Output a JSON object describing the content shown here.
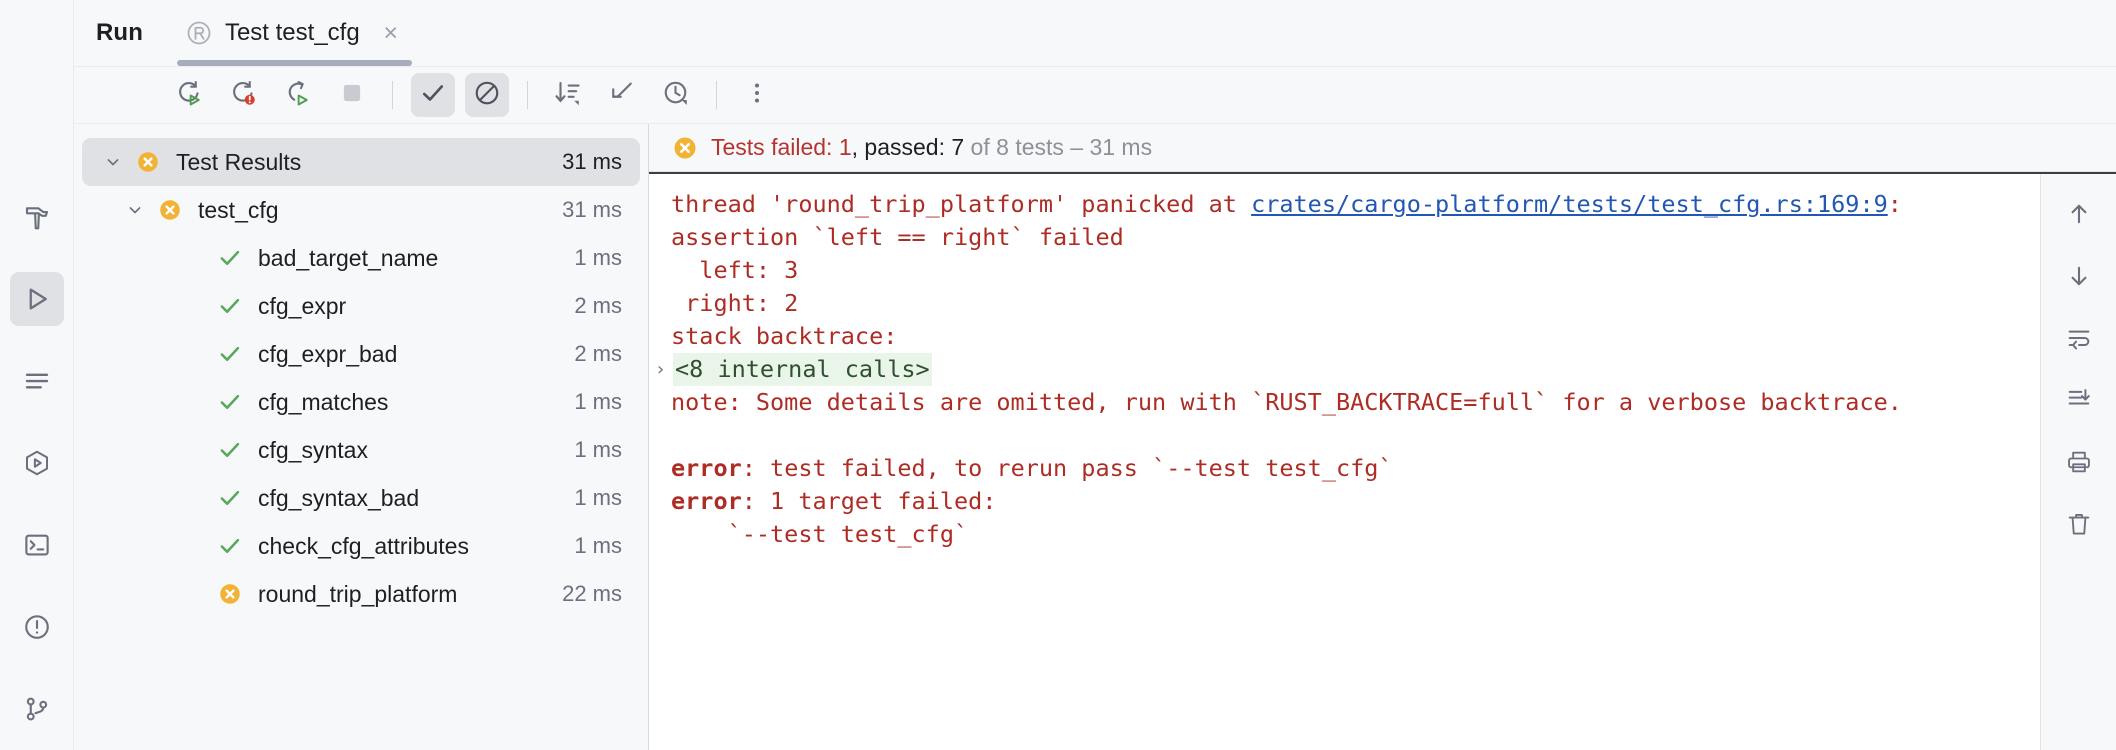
{
  "window": {
    "tool_window_title": "Run"
  },
  "tab": {
    "icon": "rust-logo-icon",
    "label": "Test test_cfg",
    "close_label": "×"
  },
  "toolbar": {
    "buttons": [
      {
        "name": "rerun-button",
        "tooltip": "Rerun",
        "icon": "rerun-icon",
        "toggled": false
      },
      {
        "name": "rerun-failed-tests-button",
        "tooltip": "Rerun Failed Tests",
        "icon": "rerun-failed-icon",
        "toggled": false
      },
      {
        "name": "toggle-auto-test-button",
        "tooltip": "Toggle auto-test",
        "icon": "auto-test-icon",
        "toggled": false
      },
      {
        "name": "stop-button",
        "tooltip": "Stop",
        "icon": "stop-icon",
        "toggled": false
      },
      {
        "name": "show-passed-button",
        "tooltip": "Show Passed",
        "icon": "check-icon",
        "toggled": true
      },
      {
        "name": "show-ignored-button",
        "tooltip": "Show Ignored",
        "icon": "no-entry-icon",
        "toggled": true
      },
      {
        "name": "sort-button",
        "tooltip": "Sort by Duration",
        "icon": "sort-descending-icon",
        "toggled": false
      },
      {
        "name": "expand-collapse-button",
        "tooltip": "Collapse",
        "icon": "collapse-arrow-icon",
        "toggled": false
      },
      {
        "name": "test-history-button",
        "tooltip": "Test History",
        "icon": "clock-icon",
        "toggled": false
      },
      {
        "name": "more-options-button",
        "tooltip": "More Options",
        "icon": "vertical-ellipsis-icon",
        "toggled": false
      }
    ]
  },
  "gutter": {
    "items": [
      {
        "name": "sidebar-item-build",
        "icon": "hammer-icon",
        "active": false
      },
      {
        "name": "sidebar-item-run",
        "icon": "play-icon",
        "active": true
      },
      {
        "name": "sidebar-item-todo",
        "icon": "lines-icon",
        "active": false
      },
      {
        "name": "sidebar-item-services",
        "icon": "hexagon-play-icon",
        "active": false
      },
      {
        "name": "sidebar-item-terminal",
        "icon": "terminal-icon",
        "active": false
      },
      {
        "name": "sidebar-item-problems",
        "icon": "warning-circle-icon",
        "active": false
      },
      {
        "name": "sidebar-item-version-control",
        "icon": "git-branch-icon",
        "active": false
      }
    ]
  },
  "tree": {
    "rows": [
      {
        "label": "Test Results",
        "time": "31 ms",
        "status": "failed",
        "indent": 1,
        "arrow": "expanded",
        "selected": true
      },
      {
        "label": "test_cfg",
        "time": "31 ms",
        "status": "failed",
        "indent": 2,
        "arrow": "expanded",
        "selected": false
      },
      {
        "label": "bad_target_name",
        "time": "1 ms",
        "status": "passed",
        "indent": 3,
        "arrow": "none",
        "selected": false
      },
      {
        "label": "cfg_expr",
        "time": "2 ms",
        "status": "passed",
        "indent": 3,
        "arrow": "none",
        "selected": false
      },
      {
        "label": "cfg_expr_bad",
        "time": "2 ms",
        "status": "passed",
        "indent": 3,
        "arrow": "none",
        "selected": false
      },
      {
        "label": "cfg_matches",
        "time": "1 ms",
        "status": "passed",
        "indent": 3,
        "arrow": "none",
        "selected": false
      },
      {
        "label": "cfg_syntax",
        "time": "1 ms",
        "status": "passed",
        "indent": 3,
        "arrow": "none",
        "selected": false
      },
      {
        "label": "cfg_syntax_bad",
        "time": "1 ms",
        "status": "passed",
        "indent": 3,
        "arrow": "none",
        "selected": false
      },
      {
        "label": "check_cfg_attributes",
        "time": "1 ms",
        "status": "passed",
        "indent": 3,
        "arrow": "none",
        "selected": false
      },
      {
        "label": "round_trip_platform",
        "time": "22 ms",
        "status": "failed",
        "indent": 3,
        "arrow": "none",
        "selected": false
      }
    ]
  },
  "status": {
    "icon": "failed-icon",
    "failed_prefix": "Tests failed: ",
    "failed_count": "1",
    "passed_prefix": ", passed: ",
    "passed_count": "7",
    "suffix": " of 8 tests – 31 ms"
  },
  "console": {
    "lines": [
      {
        "type": "mixed",
        "segments": [
          {
            "text": "thread 'round_trip_platform' panicked at ",
            "style": "err"
          },
          {
            "text": "crates/cargo-platform/tests/test_cfg.rs:169:9",
            "style": "link"
          },
          {
            "text": ":",
            "style": "err"
          }
        ]
      },
      {
        "type": "plain",
        "text": "assertion `left == right` failed",
        "style": "err"
      },
      {
        "type": "plain",
        "text": "  left: 3",
        "style": "err"
      },
      {
        "type": "plain",
        "text": " right: 2",
        "style": "err"
      },
      {
        "type": "plain",
        "text": "stack backtrace:",
        "style": "err"
      },
      {
        "type": "fold",
        "text": "<8 internal calls>",
        "style": "fold",
        "arrow": "›"
      },
      {
        "type": "plain",
        "text": "note: Some details are omitted, run with `RUST_BACKTRACE=full` for a verbose backtrace.",
        "style": "err"
      },
      {
        "type": "plain",
        "text": "",
        "style": "err"
      },
      {
        "type": "mixed",
        "segments": [
          {
            "text": "error",
            "style": "bold"
          },
          {
            "text": ": test failed, to rerun pass `--test test_cfg`",
            "style": "err"
          }
        ]
      },
      {
        "type": "mixed",
        "segments": [
          {
            "text": "error",
            "style": "bold"
          },
          {
            "text": ": 1 target failed:",
            "style": "err"
          }
        ]
      },
      {
        "type": "plain",
        "text": "    `--test test_cfg`",
        "style": "err"
      }
    ]
  },
  "console_tools": {
    "buttons": [
      {
        "name": "prev-occurrence-button",
        "icon": "arrow-up-icon"
      },
      {
        "name": "next-occurrence-button",
        "icon": "arrow-down-icon"
      },
      {
        "name": "soft-wrap-button",
        "icon": "soft-wrap-icon"
      },
      {
        "name": "scroll-to-end-button",
        "icon": "scroll-to-end-icon"
      },
      {
        "name": "print-button",
        "icon": "printer-icon"
      },
      {
        "name": "clear-all-button",
        "icon": "trash-icon"
      }
    ]
  },
  "colors": {
    "failed": "#f2b233",
    "passed": "#5aa55a",
    "error_text": "#ad2d25",
    "link": "#2357b3",
    "accent_underline": "#a8adbd"
  }
}
